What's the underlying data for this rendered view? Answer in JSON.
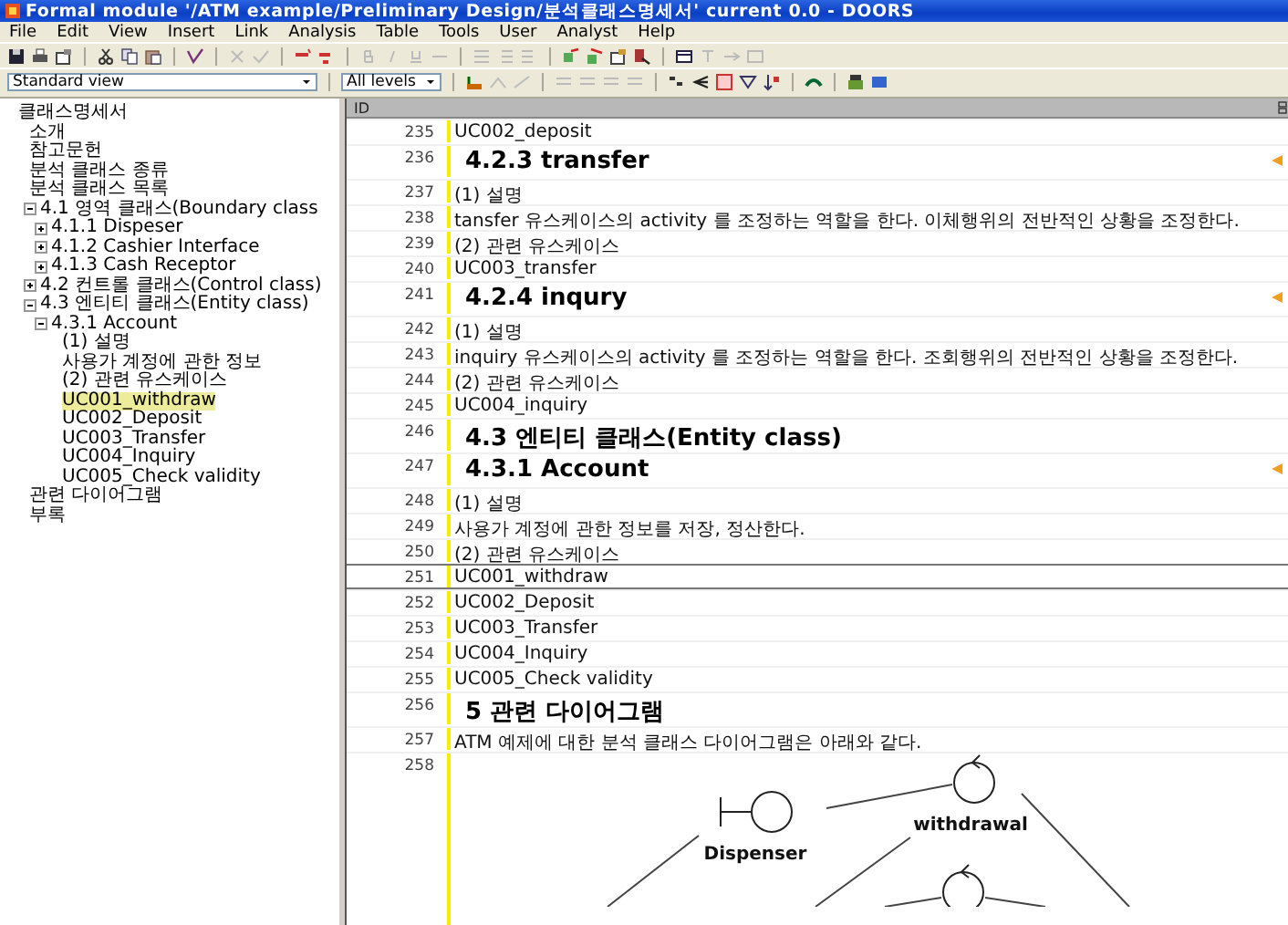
{
  "window": {
    "title": "Formal module '/ATM example/Preliminary Design/분석클래스명세서' current 0.0 - DOORS"
  },
  "menu": [
    "File",
    "Edit",
    "View",
    "Insert",
    "Link",
    "Analysis",
    "Table",
    "Tools",
    "User",
    "Analyst",
    "Help"
  ],
  "view_selector": {
    "value": "Standard view"
  },
  "level_selector": {
    "value": "All levels"
  },
  "tree": [
    {
      "label": "클래스명세서",
      "selected": false,
      "children": [
        {
          "label": "소개",
          "selected": false
        },
        {
          "label": "참고문헌",
          "selected": false
        },
        {
          "label": "분석 클래스 종류",
          "selected": false
        },
        {
          "label": "분석 클래스 목록",
          "selected": false,
          "children": [
            {
              "label": "4.1 영역 클래스(Boundary class",
              "selected": false,
              "expanded": true,
              "children": [
                {
                  "label": "4.1.1 Dispeser",
                  "selected": false,
                  "expanded": false
                },
                {
                  "label": "4.1.2 Cashier Interface",
                  "selected": false,
                  "expanded": false
                },
                {
                  "label": "4.1.3 Cash Receptor",
                  "selected": false,
                  "expanded": false
                }
              ]
            },
            {
              "label": "4.2 컨트롤 클래스(Control class)",
              "selected": false,
              "expanded": false
            },
            {
              "label": "4.3 엔티티 클래스(Entity class)",
              "selected": false,
              "expanded": true,
              "children": [
                {
                  "label": "4.3.1 Account",
                  "selected": false,
                  "expanded": true,
                  "children": [
                    {
                      "label": "(1) 설명",
                      "selected": false
                    },
                    {
                      "label": "사용가 계정에 관한 정보",
                      "selected": false
                    },
                    {
                      "label": "(2) 관련 유스케이스",
                      "selected": false
                    },
                    {
                      "label": "UC001_withdraw",
                      "selected": true
                    },
                    {
                      "label": "UC002_Deposit",
                      "selected": false
                    },
                    {
                      "label": "UC003_Transfer",
                      "selected": false
                    },
                    {
                      "label": "UC004_Inquiry",
                      "selected": false
                    },
                    {
                      "label": "UC005_Check validity",
                      "selected": false
                    }
                  ]
                }
              ]
            }
          ]
        },
        {
          "label": "관련 다이어그램",
          "selected": false
        },
        {
          "label": "부록",
          "selected": false
        }
      ]
    }
  ],
  "table": {
    "columns": [
      "ID"
    ],
    "rows": [
      {
        "id": "235",
        "kind": "body",
        "text": "UC002_deposit",
        "selected": false,
        "marked": false
      },
      {
        "id": "236",
        "kind": "heading",
        "text": "4.2.3 transfer",
        "selected": false,
        "marked": true
      },
      {
        "id": "237",
        "kind": "body",
        "text": "(1) 설명",
        "selected": false,
        "marked": false
      },
      {
        "id": "238",
        "kind": "body",
        "text": "tansfer 유스케이스의 activity 를 조정하는 역할을 한다. 이체행위의 전반적인 상황을 조정한다.",
        "selected": false,
        "marked": false
      },
      {
        "id": "239",
        "kind": "body",
        "text": "(2) 관련 유스케이스",
        "selected": false,
        "marked": false
      },
      {
        "id": "240",
        "kind": "body",
        "text": "UC003_transfer",
        "selected": false,
        "marked": false
      },
      {
        "id": "241",
        "kind": "heading",
        "text": "4.2.4 inqury",
        "selected": false,
        "marked": true
      },
      {
        "id": "242",
        "kind": "body",
        "text": "(1) 설명",
        "selected": false,
        "marked": false
      },
      {
        "id": "243",
        "kind": "body",
        "text": "inquiry 유스케이스의 activity 를 조정하는 역할을 한다. 조회행위의 전반적인 상황을 조정한다.",
        "selected": false,
        "marked": false
      },
      {
        "id": "244",
        "kind": "body",
        "text": "(2) 관련 유스케이스",
        "selected": false,
        "marked": false
      },
      {
        "id": "245",
        "kind": "body",
        "text": "UC004_inquiry",
        "selected": false,
        "marked": false
      },
      {
        "id": "246",
        "kind": "heading",
        "text": "4.3 엔티티 클래스(Entity class)",
        "selected": false,
        "marked": false
      },
      {
        "id": "247",
        "kind": "heading",
        "text": "4.3.1 Account",
        "selected": false,
        "marked": true
      },
      {
        "id": "248",
        "kind": "body",
        "text": "(1) 설명",
        "selected": false,
        "marked": false
      },
      {
        "id": "249",
        "kind": "body",
        "text": " 사용가 계정에 관한 정보를 저장, 정산한다.",
        "selected": false,
        "marked": false
      },
      {
        "id": "250",
        "kind": "body",
        "text": "(2) 관련 유스케이스",
        "selected": false,
        "marked": false
      },
      {
        "id": "251",
        "kind": "body",
        "text": "UC001_withdraw",
        "selected": true,
        "marked": false
      },
      {
        "id": "252",
        "kind": "body",
        "text": "UC002_Deposit",
        "selected": false,
        "marked": false
      },
      {
        "id": "253",
        "kind": "body",
        "text": "UC003_Transfer",
        "selected": false,
        "marked": false
      },
      {
        "id": "254",
        "kind": "body",
        "text": "UC004_Inquiry",
        "selected": false,
        "marked": false
      },
      {
        "id": "255",
        "kind": "body",
        "text": "UC005_Check validity",
        "selected": false,
        "marked": false
      },
      {
        "id": "256",
        "kind": "heading",
        "text": "5 관련 다이어그램",
        "selected": false,
        "marked": false
      },
      {
        "id": "257",
        "kind": "body",
        "text": "ATM 예제에 대한 분석 클래스 다이어그램은 아래와 같다.",
        "selected": false,
        "marked": false
      },
      {
        "id": "258",
        "kind": "diagram",
        "selected": false,
        "marked": false,
        "diagram": {
          "nodes": [
            {
              "kind": "boundary",
              "label": "Dispenser"
            },
            {
              "kind": "control",
              "label": "withdrawal"
            },
            {
              "kind": "control"
            }
          ]
        }
      }
    ]
  }
}
